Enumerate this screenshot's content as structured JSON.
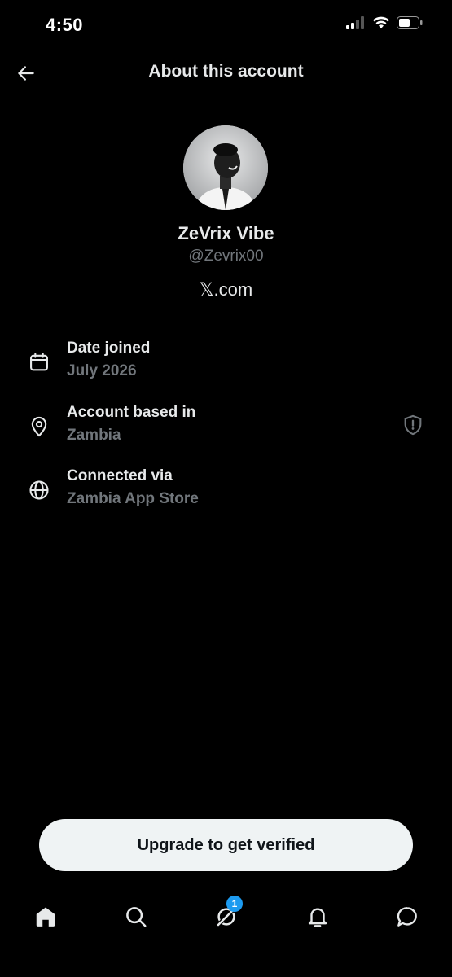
{
  "status_bar": {
    "time": "4:50",
    "icons": [
      "signal-icon",
      "wifi-icon",
      "battery-icon"
    ]
  },
  "header": {
    "title": "About this account",
    "back_icon": "arrow-left-icon"
  },
  "profile": {
    "display_name": "ZeVrix Vibe",
    "handle": "@Zevrix00",
    "site": "𝕏.com"
  },
  "info": [
    {
      "icon": "calendar-icon",
      "label": "Date joined",
      "value": "July 2026"
    },
    {
      "icon": "location-pin-icon",
      "label": "Account based in",
      "value": "Zambia",
      "trailing_icon": "shield-alert-icon"
    },
    {
      "icon": "globe-icon",
      "label": "Connected via",
      "value": "Zambia App Store"
    }
  ],
  "upgrade": {
    "label": "Upgrade to get verified"
  },
  "bottom_nav": {
    "items": [
      "home-icon",
      "search-icon",
      "grok-icon",
      "bell-icon",
      "messages-icon"
    ],
    "badge": "1"
  },
  "colors": {
    "background": "#000000",
    "primary_text": "#e7e9ea",
    "secondary_text": "#71767b",
    "accent": "#1d9bf0",
    "button_bg": "#eff3f4"
  }
}
